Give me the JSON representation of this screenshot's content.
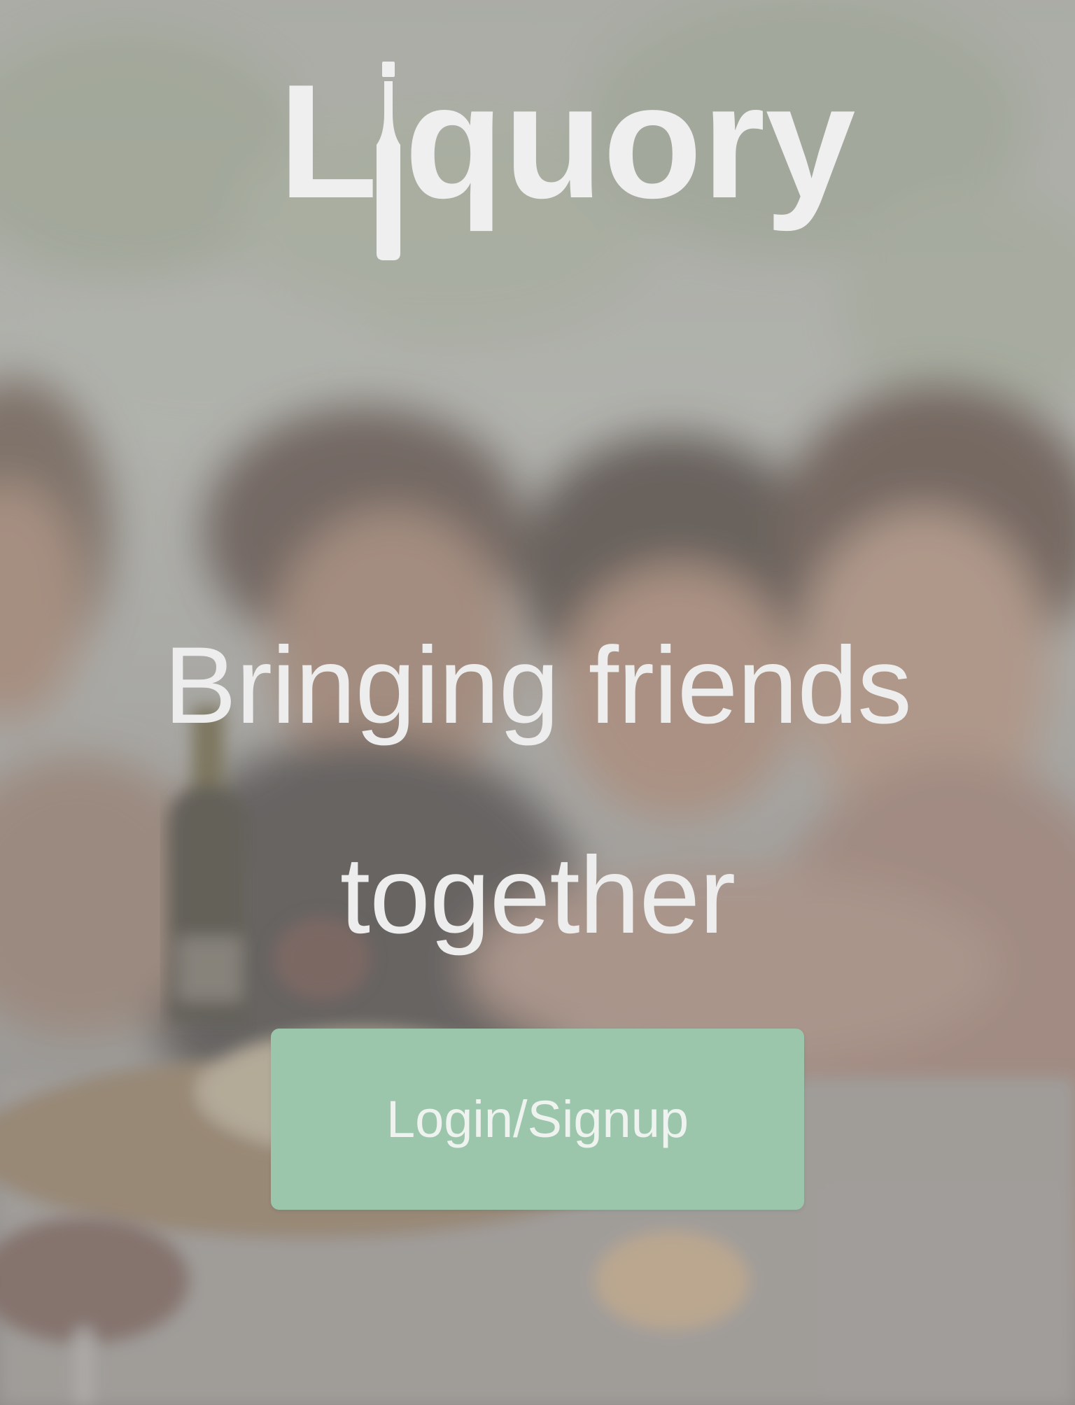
{
  "brand": {
    "name_prefix": "L",
    "name_suffix": "quory",
    "logo_text": "Liquory",
    "bottle_icon": "bottle-icon"
  },
  "hero": {
    "line1": "Bringing friends",
    "line2": "together"
  },
  "actions": {
    "login_signup": "Login/Signup"
  },
  "colors": {
    "text": "#efefef",
    "button_bg": "#9bc6ab",
    "overlay": "#969696"
  }
}
